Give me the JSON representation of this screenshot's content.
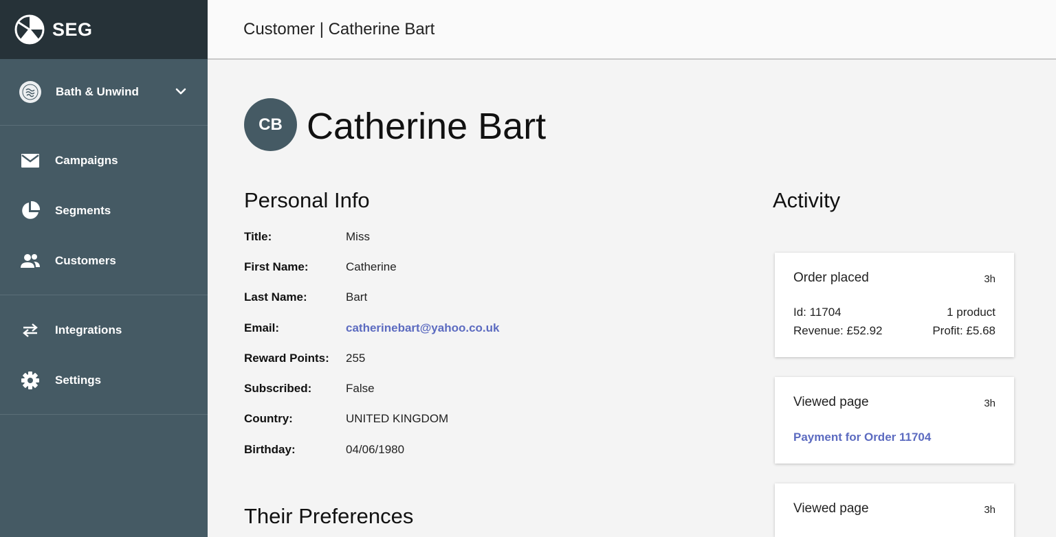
{
  "brand": {
    "name": "SEG",
    "logo_icon": "segment-logo-icon"
  },
  "store": {
    "name": "Bath & Unwind",
    "logo_icon": "store-logo-icon"
  },
  "nav": {
    "group1": [
      {
        "label": "Campaigns",
        "icon": "envelope-icon"
      },
      {
        "label": "Segments",
        "icon": "pie-chart-icon"
      },
      {
        "label": "Customers",
        "icon": "people-icon"
      }
    ],
    "group2": [
      {
        "label": "Integrations",
        "icon": "swap-arrows-icon"
      },
      {
        "label": "Settings",
        "icon": "gear-icon"
      }
    ]
  },
  "header": {
    "title": "Customer | Catherine Bart"
  },
  "customer": {
    "initials": "CB",
    "name": "Catherine Bart"
  },
  "personal_info": {
    "heading": "Personal Info",
    "rows": [
      {
        "label": "Title:",
        "value": "Miss"
      },
      {
        "label": "First Name:",
        "value": "Catherine"
      },
      {
        "label": "Last Name:",
        "value": "Bart"
      },
      {
        "label": "Email:",
        "value": "catherinebart@yahoo.co.uk"
      },
      {
        "label": "Reward Points:",
        "value": "255"
      },
      {
        "label": "Subscribed:",
        "value": "False"
      },
      {
        "label": "Country:",
        "value": "UNITED KINGDOM"
      },
      {
        "label": "Birthday:",
        "value": "04/06/1980"
      }
    ]
  },
  "preferences": {
    "heading": "Their Preferences"
  },
  "activity": {
    "heading": "Activity",
    "cards": [
      {
        "title": "Order placed",
        "time": "3h",
        "id_text": "Id: 11704",
        "products": "1 product",
        "revenue": "Revenue: £52.92",
        "profit": "Profit:  £5.68"
      },
      {
        "title": "Viewed page",
        "time": "3h",
        "link": "Payment for Order 11704"
      },
      {
        "title": "Viewed page",
        "time": "3h"
      }
    ]
  },
  "colors": {
    "sidebar": "#455a64",
    "sidebar_brand": "#263238",
    "accent_link": "#5c6bc0"
  }
}
